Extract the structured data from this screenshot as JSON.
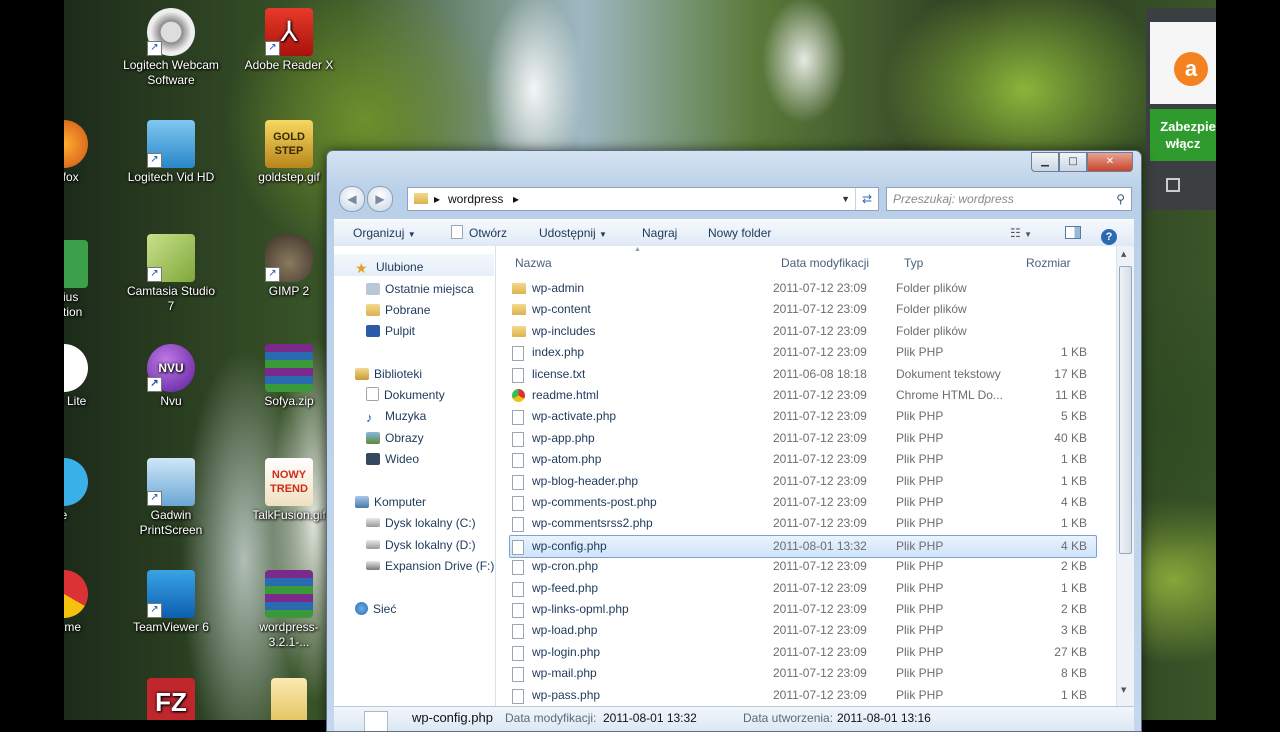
{
  "desktop": {
    "icons": [
      {
        "label": "Logitech Webcam\nSoftware",
        "icon": "webcam-icon"
      },
      {
        "label": "Adobe Reader X",
        "icon": "pdf-icon"
      },
      {
        "label": "irefox",
        "icon": "firefox-icon"
      },
      {
        "label": "Logitech Vid HD",
        "icon": "logitech-vid-icon"
      },
      {
        "label": "goldstep.gif",
        "icon": "gif-image-icon"
      },
      {
        "label": "enius\nEdition",
        "icon": "app-icon"
      },
      {
        "label": "Camtasia Studio 7",
        "icon": "camtasia-icon"
      },
      {
        "label": "GIMP 2",
        "icon": "gimp-icon"
      },
      {
        "label": "ools Lite",
        "icon": "app-icon"
      },
      {
        "label": "Nvu",
        "icon": "nvu-icon"
      },
      {
        "label": "Sofya.zip",
        "icon": "winrar-archive-icon"
      },
      {
        "label": "e",
        "icon": "app-icon"
      },
      {
        "label": "Gadwin PrintScreen",
        "icon": "gadwin-icon"
      },
      {
        "label": "TalkFusion.gif",
        "icon": "gif-image-icon"
      },
      {
        "label": "hrome",
        "icon": "chrome-icon"
      },
      {
        "label": "TeamViewer 6",
        "icon": "teamviewer-icon"
      },
      {
        "label": "wordpress-3.2.1-...",
        "icon": "winrar-archive-icon"
      }
    ],
    "nvu_badge": "NVU",
    "adobe_glyph": "⅄",
    "goldstep_text": "GOLD STEP",
    "nowy_trend_text": "NOWY TREND"
  },
  "avast": {
    "text1": "Zabezpie",
    "text2": "włącz",
    "logo_letter": "a"
  },
  "window": {
    "controls": {
      "minimize": "▁",
      "maximize": "□",
      "close": "✕"
    },
    "address": {
      "path": "wordpress",
      "sep": "▸"
    },
    "search_placeholder": "Przeszukaj: wordpress",
    "toolbar": {
      "organize": "Organizuj",
      "open": "Otwórz",
      "share": "Udostępnij",
      "burn": "Nagraj",
      "new_folder": "Nowy folder"
    },
    "nav": {
      "favorites": "Ulubione",
      "recent": "Ostatnie miejsca",
      "downloads": "Pobrane",
      "desktop": "Pulpit",
      "libraries": "Biblioteki",
      "documents": "Dokumenty",
      "music": "Muzyka",
      "pictures": "Obrazy",
      "videos": "Wideo",
      "computer": "Komputer",
      "disk_c": "Dysk lokalny (C:)",
      "disk_d": "Dysk lokalny (D:)",
      "expansion": "Expansion Drive (F:)",
      "network": "Sieć"
    },
    "columns": {
      "name": "Nazwa",
      "date": "Data modyfikacji",
      "type": "Typ",
      "size": "Rozmiar"
    },
    "files": [
      {
        "name": "wp-admin",
        "date": "2011-07-12 23:09",
        "type": "Folder plików",
        "size": "",
        "kind": "folder"
      },
      {
        "name": "wp-content",
        "date": "2011-07-12 23:09",
        "type": "Folder plików",
        "size": "",
        "kind": "folder"
      },
      {
        "name": "wp-includes",
        "date": "2011-07-12 23:09",
        "type": "Folder plików",
        "size": "",
        "kind": "folder"
      },
      {
        "name": "index.php",
        "date": "2011-07-12 23:09",
        "type": "Plik PHP",
        "size": "1 KB",
        "kind": "file"
      },
      {
        "name": "license.txt",
        "date": "2011-06-08 18:18",
        "type": "Dokument tekstowy",
        "size": "17 KB",
        "kind": "file"
      },
      {
        "name": "readme.html",
        "date": "2011-07-12 23:09",
        "type": "Chrome HTML Do...",
        "size": "11 KB",
        "kind": "chrome"
      },
      {
        "name": "wp-activate.php",
        "date": "2011-07-12 23:09",
        "type": "Plik PHP",
        "size": "5 KB",
        "kind": "file"
      },
      {
        "name": "wp-app.php",
        "date": "2011-07-12 23:09",
        "type": "Plik PHP",
        "size": "40 KB",
        "kind": "file"
      },
      {
        "name": "wp-atom.php",
        "date": "2011-07-12 23:09",
        "type": "Plik PHP",
        "size": "1 KB",
        "kind": "file"
      },
      {
        "name": "wp-blog-header.php",
        "date": "2011-07-12 23:09",
        "type": "Plik PHP",
        "size": "1 KB",
        "kind": "file"
      },
      {
        "name": "wp-comments-post.php",
        "date": "2011-07-12 23:09",
        "type": "Plik PHP",
        "size": "4 KB",
        "kind": "file"
      },
      {
        "name": "wp-commentsrss2.php",
        "date": "2011-07-12 23:09",
        "type": "Plik PHP",
        "size": "1 KB",
        "kind": "file"
      },
      {
        "name": "wp-config.php",
        "date": "2011-08-01 13:32",
        "type": "Plik PHP",
        "size": "4 KB",
        "kind": "file",
        "selected": true
      },
      {
        "name": "wp-cron.php",
        "date": "2011-07-12 23:09",
        "type": "Plik PHP",
        "size": "2 KB",
        "kind": "file"
      },
      {
        "name": "wp-feed.php",
        "date": "2011-07-12 23:09",
        "type": "Plik PHP",
        "size": "1 KB",
        "kind": "file"
      },
      {
        "name": "wp-links-opml.php",
        "date": "2011-07-12 23:09",
        "type": "Plik PHP",
        "size": "2 KB",
        "kind": "file"
      },
      {
        "name": "wp-load.php",
        "date": "2011-07-12 23:09",
        "type": "Plik PHP",
        "size": "3 KB",
        "kind": "file"
      },
      {
        "name": "wp-login.php",
        "date": "2011-07-12 23:09",
        "type": "Plik PHP",
        "size": "27 KB",
        "kind": "file"
      },
      {
        "name": "wp-mail.php",
        "date": "2011-07-12 23:09",
        "type": "Plik PHP",
        "size": "8 KB",
        "kind": "file"
      },
      {
        "name": "wp-pass.php",
        "date": "2011-07-12 23:09",
        "type": "Plik PHP",
        "size": "1 KB",
        "kind": "file"
      }
    ],
    "details": {
      "name": "wp-config.php",
      "modified_label": "Data modyfikacji:",
      "modified_value": "2011-08-01 13:32",
      "created_label": "Data utworzenia:",
      "created_value": "2011-08-01 13:16"
    }
  }
}
